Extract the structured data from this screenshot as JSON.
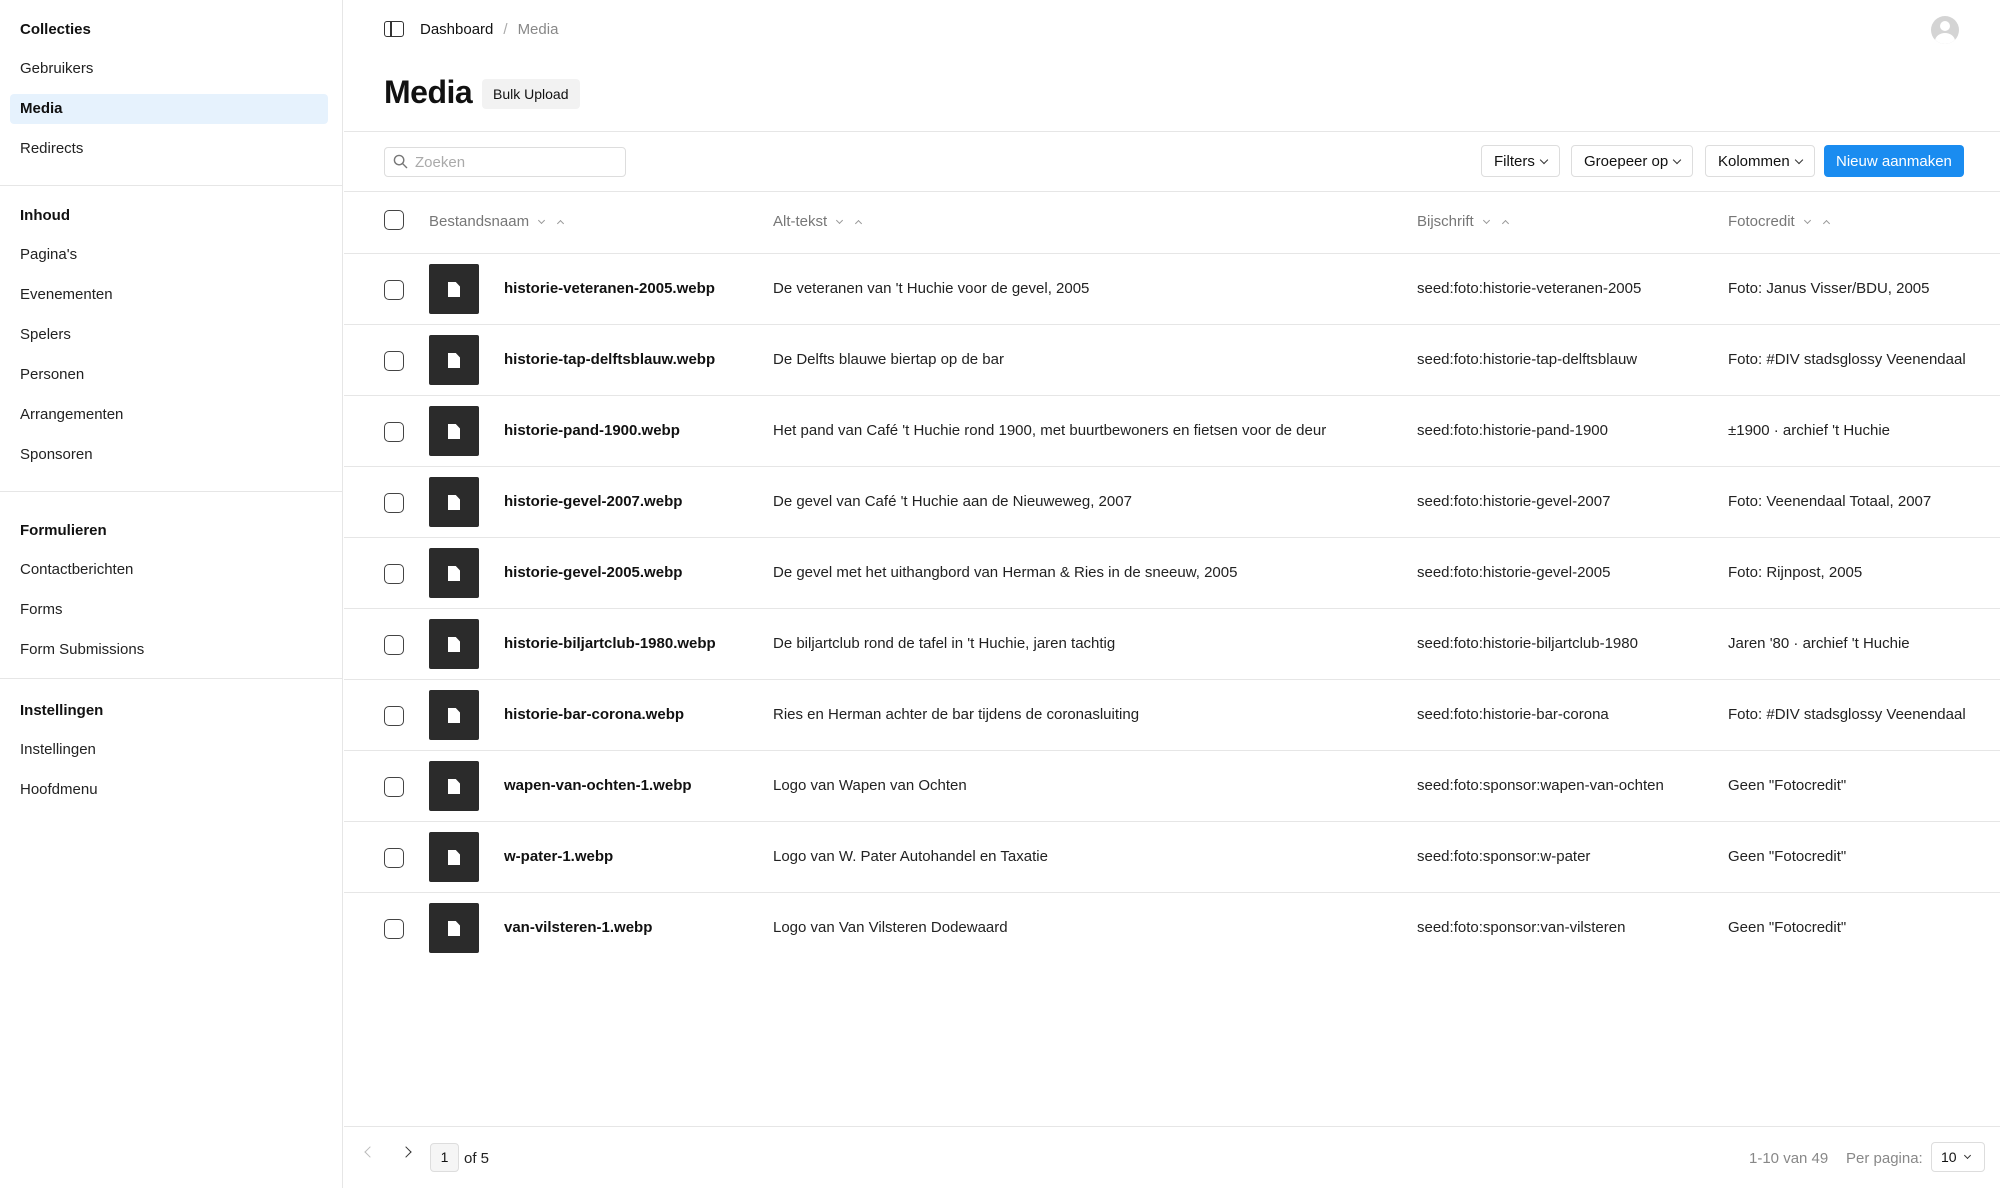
{
  "sidebar": {
    "groups": [
      {
        "title": "Collecties",
        "items": [
          "Gebruikers",
          "Media",
          "Redirects"
        ]
      },
      {
        "title": "Inhoud",
        "items": [
          "Pagina's",
          "Evenementen",
          "Spelers",
          "Personen",
          "Arrangementen",
          "Sponsoren"
        ]
      },
      {
        "title": "Formulieren",
        "items": [
          "Contactberichten",
          "Forms",
          "Form Submissions"
        ]
      },
      {
        "title": "Instellingen",
        "items": [
          "Instellingen",
          "Hoofdmenu"
        ]
      }
    ],
    "active_item": "Media"
  },
  "breadcrumb": {
    "dashboard": "Dashboard",
    "separator": "/",
    "current": "Media"
  },
  "page": {
    "title": "Media",
    "bulk_upload": "Bulk Upload"
  },
  "toolbar": {
    "search_placeholder": "Zoeken",
    "filters": "Filters",
    "group_by": "Groepeer op",
    "columns": "Kolommen",
    "create_new": "Nieuw aanmaken"
  },
  "table": {
    "headers": {
      "filename": "Bestandsnaam",
      "alt": "Alt-tekst",
      "caption": "Bijschrift",
      "credit": "Fotocredit"
    },
    "rows": [
      {
        "filename": "historie-veteranen-2005.webp",
        "alt": "De veteranen van 't Huchie voor de gevel, 2005",
        "caption": "seed:foto:historie-veteranen-2005",
        "credit": "Foto: Janus Visser/BDU, 2005"
      },
      {
        "filename": "historie-tap-delftsblauw.webp",
        "alt": "De Delfts blauwe biertap op de bar",
        "caption": "seed:foto:historie-tap-delftsblauw",
        "credit": "Foto: #DIV stadsglossy Veenendaal"
      },
      {
        "filename": "historie-pand-1900.webp",
        "alt": "Het pand van Café 't Huchie rond 1900, met buurtbewoners en fietsen voor de deur",
        "caption": "seed:foto:historie-pand-1900",
        "credit": "±1900 · archief 't Huchie"
      },
      {
        "filename": "historie-gevel-2007.webp",
        "alt": "De gevel van Café 't Huchie aan de Nieuweweg, 2007",
        "caption": "seed:foto:historie-gevel-2007",
        "credit": "Foto: Veenendaal Totaal, 2007"
      },
      {
        "filename": "historie-gevel-2005.webp",
        "alt": "De gevel met het uithangbord van Herman & Ries in de sneeuw, 2005",
        "caption": "seed:foto:historie-gevel-2005",
        "credit": "Foto: Rijnpost, 2005"
      },
      {
        "filename": "historie-biljartclub-1980.webp",
        "alt": "De biljartclub rond de tafel in 't Huchie, jaren tachtig",
        "caption": "seed:foto:historie-biljartclub-1980",
        "credit": "Jaren '80 · archief 't Huchie"
      },
      {
        "filename": "historie-bar-corona.webp",
        "alt": "Ries en Herman achter de bar tijdens de coronasluiting",
        "caption": "seed:foto:historie-bar-corona",
        "credit": "Foto: #DIV stadsglossy Veenendaal"
      },
      {
        "filename": "wapen-van-ochten-1.webp",
        "alt": "Logo van Wapen van Ochten",
        "caption": "seed:foto:sponsor:wapen-van-ochten",
        "credit": "Geen \"Fotocredit\""
      },
      {
        "filename": "w-pater-1.webp",
        "alt": "Logo van W. Pater Autohandel en Taxatie",
        "caption": "seed:foto:sponsor:w-pater",
        "credit": "Geen \"Fotocredit\""
      },
      {
        "filename": "van-vilsteren-1.webp",
        "alt": "Logo van Van Vilsteren Dodewaard",
        "caption": "seed:foto:sponsor:van-vilsteren",
        "credit": "Geen \"Fotocredit\""
      }
    ]
  },
  "pagination": {
    "page": "1",
    "of": "of 5",
    "range": "1-10 van 49",
    "per_page_label": "Per pagina:",
    "per_page": "10"
  },
  "colors": {
    "accent": "#1a8cf0",
    "active_bg": "#e6f2fd",
    "thumb": "#2b2b2b"
  }
}
